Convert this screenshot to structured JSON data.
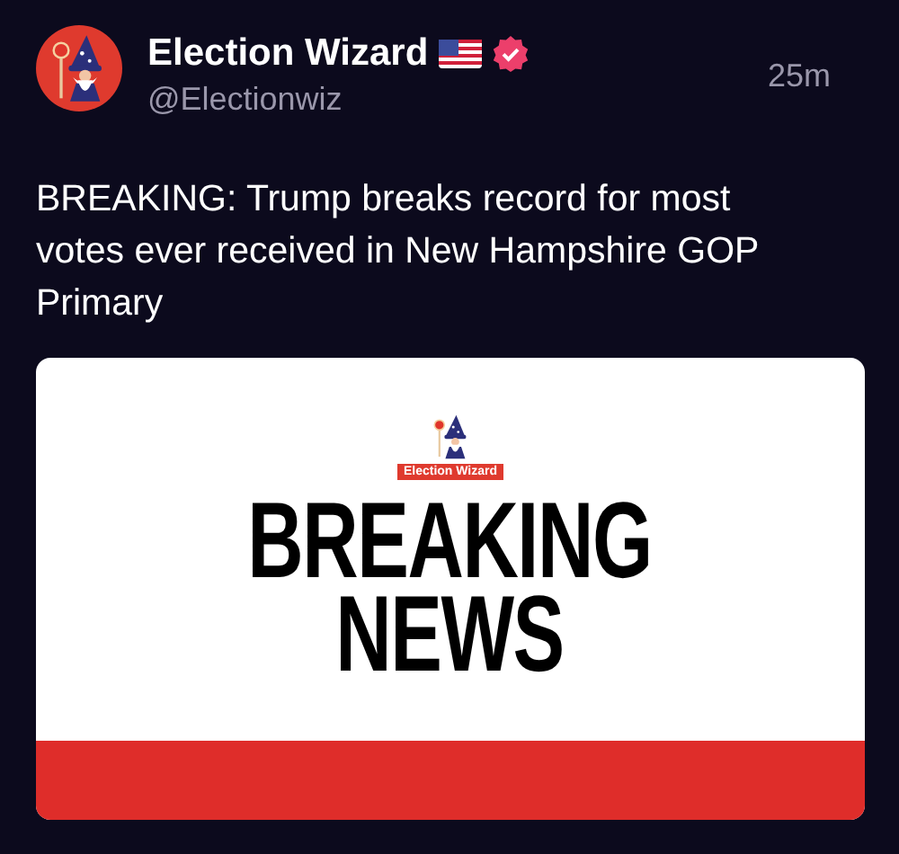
{
  "post": {
    "author": "Election Wizard",
    "verified": true,
    "handle": "@Electionwiz",
    "time": "25m",
    "text": "BREAKING: Trump breaks record for most votes ever received in New Hampshire GOP Primary"
  },
  "media": {
    "logo_label": "Election Wizard",
    "headline": [
      "BREAKING",
      "NEWS"
    ]
  }
}
